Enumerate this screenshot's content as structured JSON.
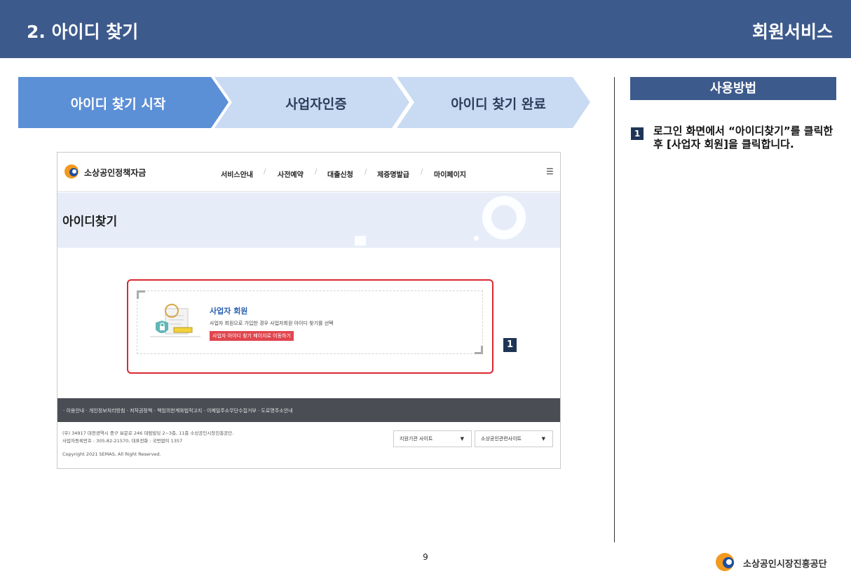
{
  "header": {
    "title": "2. 아이디 찾기",
    "section": "회원서비스"
  },
  "steps": [
    "아이디 찾기 시작",
    "사업자인증",
    "아이디 찾기 완료"
  ],
  "colors": {
    "header_bg": "#3d5a8c",
    "step_active": "#5b8fd6",
    "step_inactive": "#c9daf3",
    "highlight": "#d9282f"
  },
  "how_to": {
    "header": "사용방법",
    "items": [
      {
        "num": "1",
        "text": "로그인 화면에서 “아이디찾기”를 클릭한 후 [사업자 회원]을 클릭합니다."
      }
    ]
  },
  "screenshot": {
    "logo_text": "소상공인정책자금",
    "nav": [
      "서비스안내",
      "사전예약",
      "대출신청",
      "제증명발급",
      "마이페이지"
    ],
    "hero_title": "아이디찾기",
    "card": {
      "title": "사업자 회원",
      "desc": "사업자 회원으로 가입한 경우 사업자회원 아이디 찾기를 선택",
      "button": "사업자 아이디 찾기 페이지로 이동하기"
    },
    "footer_links": "· 이용안내   · 개인정보처리방침   · 저작권정책   · 책임의한계와법적고지   · 이메일주소무단수집거부   · 도로명주소안내",
    "address_line1": "(우) 34917 대전광역시 중구 보문로 246 대림빌딩 2~3층, 11층 소상공인시장진흥공단.",
    "address_line2": "사업자등록번호 : 305-82-21570, 대표전화 : 국번없이 1357",
    "copyright": "Copyright 2021 SEMAS, All Right Reserved.",
    "select1": "지원기관 사이트",
    "select2": "소상공인관련사이트",
    "marker": "1"
  },
  "page_number": "9",
  "footer_logo_text": "소상공인시장진흥공단"
}
